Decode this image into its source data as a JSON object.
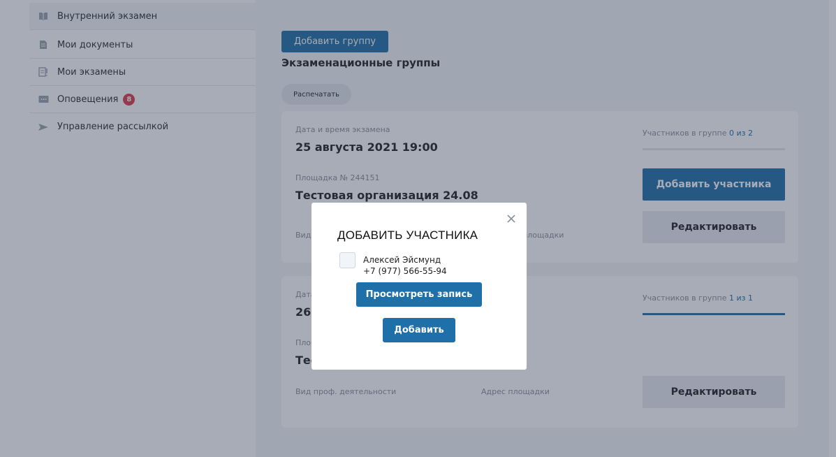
{
  "sidebar": {
    "items": [
      {
        "label": "Внутренний экзамен",
        "icon": "book-icon"
      },
      {
        "label": "Мои документы",
        "icon": "document-icon"
      },
      {
        "label": "Мои экзамены",
        "icon": "exam-list-icon"
      },
      {
        "label": "Оповещения",
        "icon": "message-icon",
        "badge": "8"
      },
      {
        "label": "Управление рассылкой",
        "icon": "send-icon"
      }
    ]
  },
  "main": {
    "add_group_label": "Добавить группу",
    "title": "Экзаменационные группы",
    "print_label": "Распечатать",
    "cards": [
      {
        "date_label": "Дата и время экзамена",
        "date_value": "25 августа 2021 19:00",
        "venue_label": "Площадка № 244151",
        "venue_value": "Тестовая организация 24.08",
        "activity_label": "Вид",
        "address_label": "площадки",
        "participants_label": "Участников в группе",
        "participants_count": "0 из 2",
        "participants_progress": 0,
        "add_participant_label": "Добавить участника",
        "edit_label": "Редактировать"
      },
      {
        "date_label": "Дата",
        "date_value": "26",
        "venue_label": "Пло",
        "venue_value": "Тес",
        "activity_label": "Вид проф. деятельности",
        "address_label": "Адрес площадки",
        "participants_label": "Участников в группе",
        "participants_count": "1 из 1",
        "participants_progress": 1,
        "edit_label": "Редактировать"
      }
    ]
  },
  "modal": {
    "title": "ДОБАВИТЬ УЧАСТНИКА",
    "person_name": "Алексей Эйсмунд",
    "person_phone": "+7 (977) 566-55-94",
    "view_record_label": "Просмотреть запись",
    "add_label": "Добавить",
    "close_icon": "close-icon"
  },
  "colors": {
    "accent": "#1f6fa8",
    "badge": "#e03a4a",
    "overlay": "rgba(45,58,80,0.42)"
  }
}
